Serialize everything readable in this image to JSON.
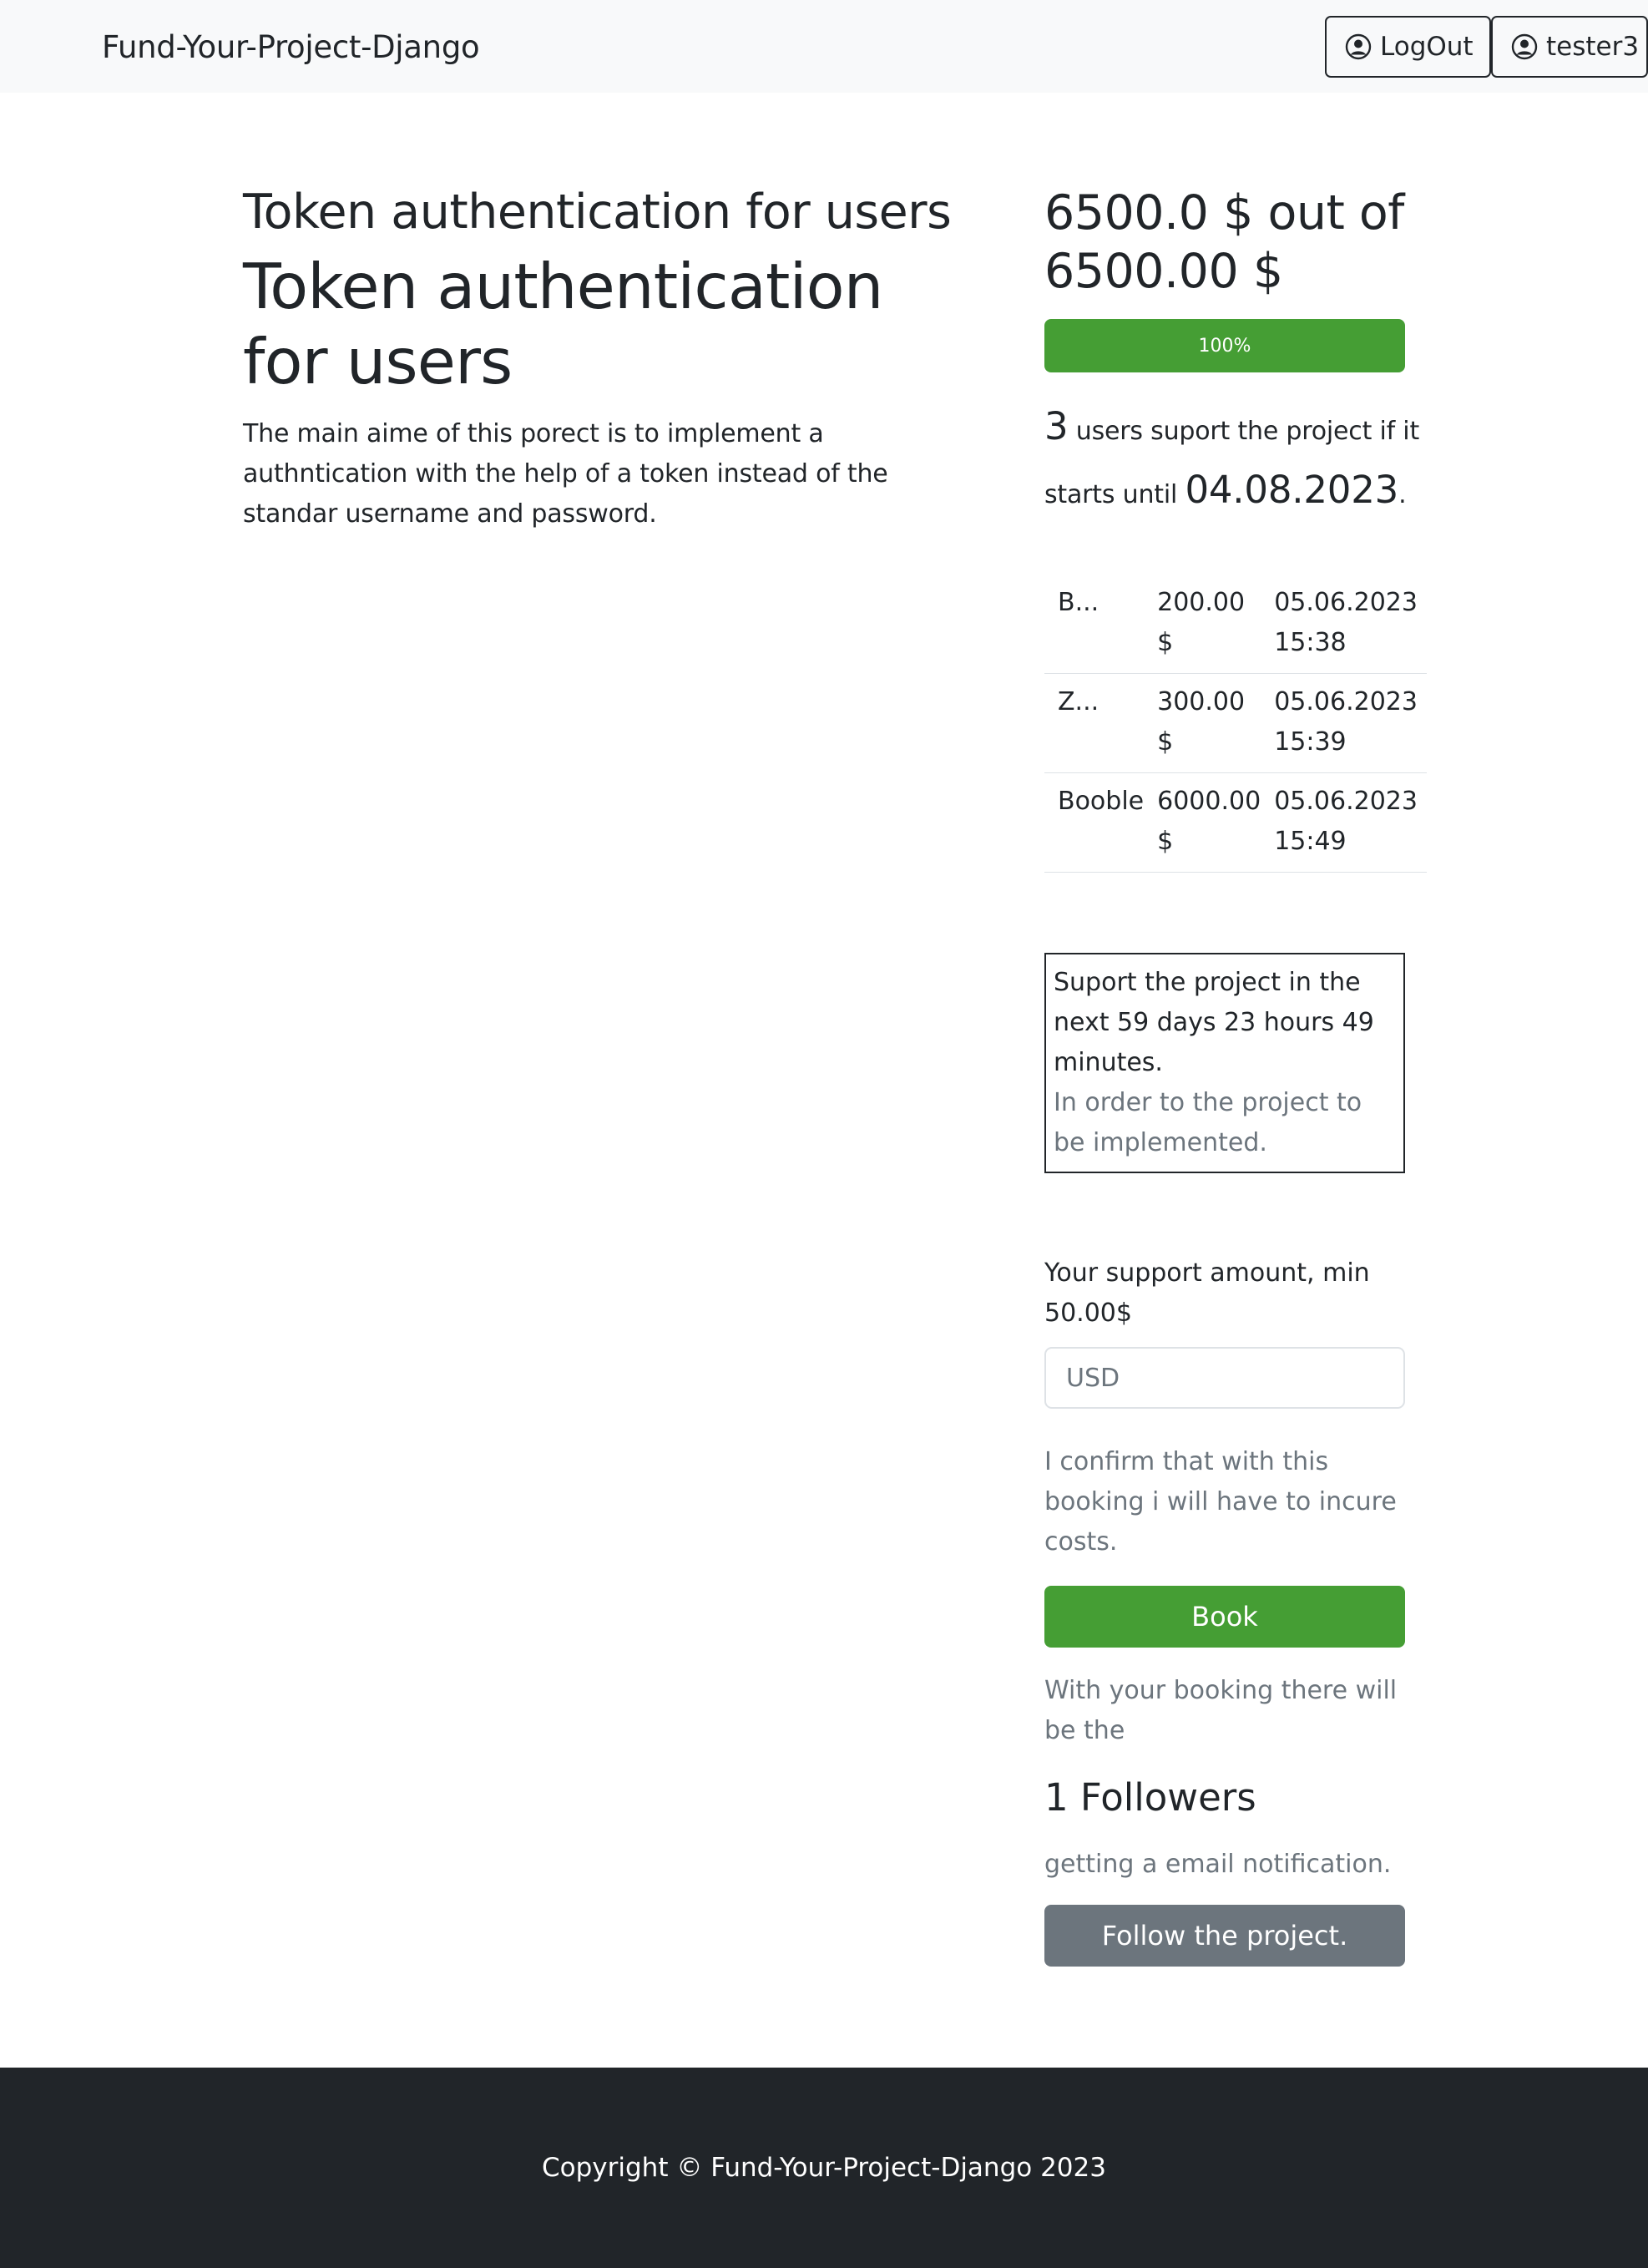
{
  "navbar": {
    "brand": "Fund-Your-Project-Django",
    "logout_label": "LogOut",
    "user_label": "tester3"
  },
  "project": {
    "title_small": "Token authentication for users",
    "title_large": "Token authentication for users",
    "description": "The main aime of this porect is to implement a authntication with the help of a token instead of the standar username and password."
  },
  "funding": {
    "goal_text": "6500.0 $ out of 6500.00 $",
    "progress_percent": 100,
    "progress_label": "100%",
    "supporters_count": "3",
    "supporters_text": " users suport the project if it starts until ",
    "deadline": "04.08.2023",
    "deadline_suffix": "."
  },
  "backers": [
    {
      "name": "B...",
      "amount": "200.00 $",
      "date": "05.06.2023 15:38"
    },
    {
      "name": "Z...",
      "amount": "300.00 $",
      "date": "05.06.2023 15:39"
    },
    {
      "name": "Booble",
      "amount": "6000.00 $",
      "date": "05.06.2023 15:49"
    }
  ],
  "countdown": {
    "text": "Suport the project in the next 59 days 23 hours 49 minutes.",
    "subtext": "In order to the project to be implemented."
  },
  "booking": {
    "amount_label": "Your support amount, min 50.00$",
    "input_placeholder": "USD",
    "confirm_text": "I confirm that with this booking i will have to incure costs.",
    "book_label": "Book",
    "note": "With your booking there will be the",
    "followers_text": "1 Followers",
    "notification_text": "getting a email notification.",
    "follow_label": "Follow the project."
  },
  "footer": {
    "text": "Copyright © Fund-Your-Project-Django 2023"
  },
  "colors": {
    "success": "#459e34",
    "secondary": "#6c757d",
    "footer_bg": "#212529",
    "navbar_bg": "#f8f9fa"
  }
}
